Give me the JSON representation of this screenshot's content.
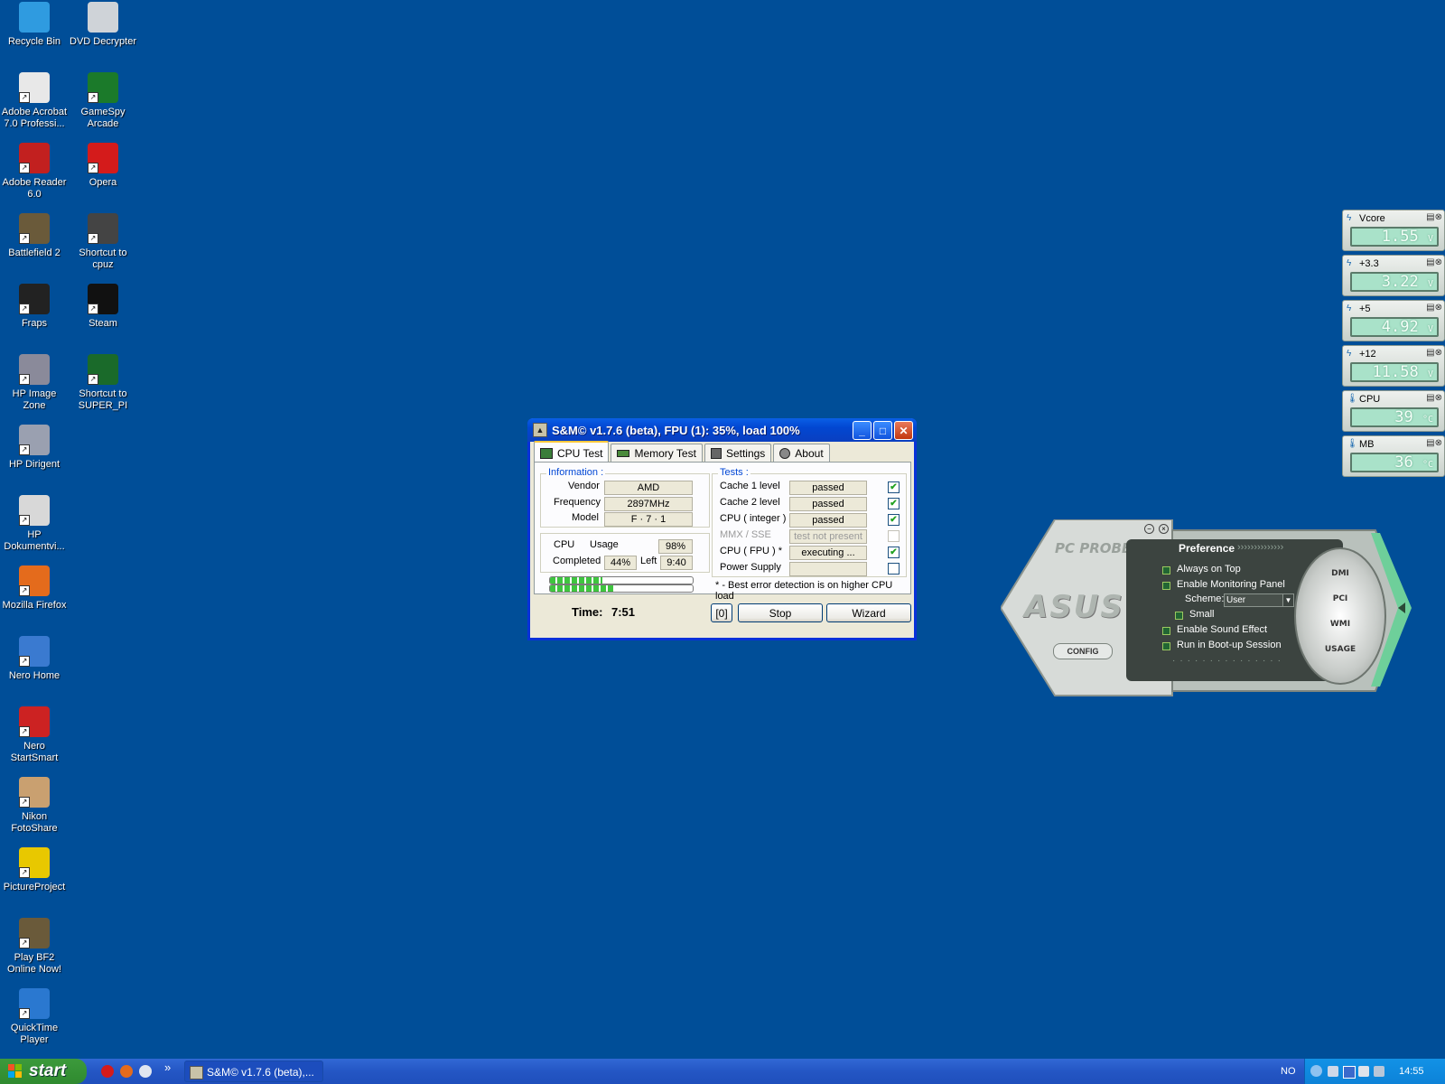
{
  "desktop": {
    "icons": [
      {
        "label": "Recycle Bin",
        "color": "#2f9be0"
      },
      {
        "label": "DVD Decrypter",
        "color": "#cfd3d8"
      },
      {
        "label": "Adobe Acrobat 7.0 Professi...",
        "color": "#e8e8e8"
      },
      {
        "label": "GameSpy Arcade",
        "color": "#1b7a2a"
      },
      {
        "label": "Adobe Reader 6.0",
        "color": "#c2201f"
      },
      {
        "label": "Opera",
        "color": "#d41b1b"
      },
      {
        "label": "Battlefield 2",
        "color": "#6a5a3a"
      },
      {
        "label": "Shortcut to cpuz",
        "color": "#444444"
      },
      {
        "label": "Fraps",
        "color": "#222222"
      },
      {
        "label": "Steam",
        "color": "#111111"
      },
      {
        "label": "HP Image Zone",
        "color": "#8a8a9a"
      },
      {
        "label": "Shortcut to SUPER_PI",
        "color": "#1a6a2a"
      },
      {
        "label": "HP Dirigent",
        "color": "#9aa0b0"
      },
      {
        "label": "HP Dokumentvi...",
        "color": "#d8d8d8"
      },
      {
        "label": "Mozilla Firefox",
        "color": "#e46b1c"
      },
      {
        "label": "Nero Home",
        "color": "#3a7ad0"
      },
      {
        "label": "Nero StartSmart",
        "color": "#cc2222"
      },
      {
        "label": "Nikon FotoShare",
        "color": "#c9a070"
      },
      {
        "label": "PictureProject",
        "color": "#e8c800"
      },
      {
        "label": "Play BF2 Online Now!",
        "color": "#6a5a3a"
      },
      {
        "label": "QuickTime Player",
        "color": "#2a78d0"
      }
    ]
  },
  "window": {
    "title": "S&M© v1.7.6 (beta), FPU (1): 35%, load 100%",
    "controls": {
      "minimize": "_",
      "maximize": "□",
      "close": "✕"
    },
    "tabs": [
      {
        "label": "CPU Test",
        "active": true
      },
      {
        "label": "Memory Test",
        "active": false
      },
      {
        "label": "Settings",
        "active": false
      },
      {
        "label": "About",
        "active": false
      }
    ],
    "information": {
      "heading": "Information :",
      "vendor_label": "Vendor",
      "vendor": "AMD",
      "frequency_label": "Frequency",
      "frequency": "2897MHz",
      "model_label": "Model",
      "model": "F · 7 · 1"
    },
    "cpu": {
      "cpu_label": "CPU",
      "usage_label": "Usage",
      "usage": "98%",
      "completed_label": "Completed",
      "completed": "44%",
      "left_label": "Left",
      "left": "9:40",
      "progress1": 0.37,
      "progress2": 0.44
    },
    "tests": {
      "heading": "Tests :",
      "items": [
        {
          "label": "Cache 1 level",
          "status": "passed",
          "checked": "✔",
          "enabled": true
        },
        {
          "label": "Cache 2 level",
          "status": "passed",
          "checked": "✔",
          "enabled": true
        },
        {
          "label": "CPU ( integer )",
          "status": "passed",
          "checked": "✔",
          "enabled": true
        },
        {
          "label": "MMX / SSE",
          "status": "test not present",
          "checked": "",
          "enabled": false
        },
        {
          "label": "CPU ( FPU ) *",
          "status": "executing ...",
          "checked": "✔",
          "enabled": true
        },
        {
          "label": "Power Supply",
          "status": "",
          "checked": "",
          "enabled": true
        }
      ],
      "note": "* - Best error detection is on higher CPU load"
    },
    "footer": {
      "time_label": "Time:",
      "time": "7:51",
      "counter": "[0]",
      "stop": "Stop",
      "wizard": "Wizard"
    }
  },
  "sensors": [
    {
      "name": "Vcore",
      "value": "1.55",
      "unit": "V",
      "type": "voltage"
    },
    {
      "name": "+3.3",
      "value": "3.22",
      "unit": "V",
      "type": "voltage"
    },
    {
      "name": "+5",
      "value": "4.92",
      "unit": "V",
      "type": "voltage"
    },
    {
      "name": "+12",
      "value": "11.58",
      "unit": "V",
      "type": "voltage"
    },
    {
      "name": "CPU",
      "value": "39",
      "unit": "°C",
      "type": "temperature"
    },
    {
      "name": "MB",
      "value": "36",
      "unit": "°C",
      "type": "temperature"
    }
  ],
  "pcprobe": {
    "title": "PC PROBE II",
    "brand": "ASUS",
    "config": "CONFIG",
    "preference_title": "Preference",
    "options": [
      {
        "label": "Always on Top"
      },
      {
        "label": "Enable Monitoring Panel"
      },
      {
        "label": "Small"
      },
      {
        "label": "Enable Sound Effect"
      },
      {
        "label": "Run in Boot-up Session"
      }
    ],
    "scheme_label": "Scheme:",
    "scheme_value": "User",
    "buttons": [
      "DMI",
      "PCI",
      "WMI",
      "USAGE"
    ]
  },
  "taskbar": {
    "start": "start",
    "task_label": "S&M© v1.7.6 (beta),...",
    "language": "NO",
    "clock": "14:55",
    "overflow": "»"
  }
}
